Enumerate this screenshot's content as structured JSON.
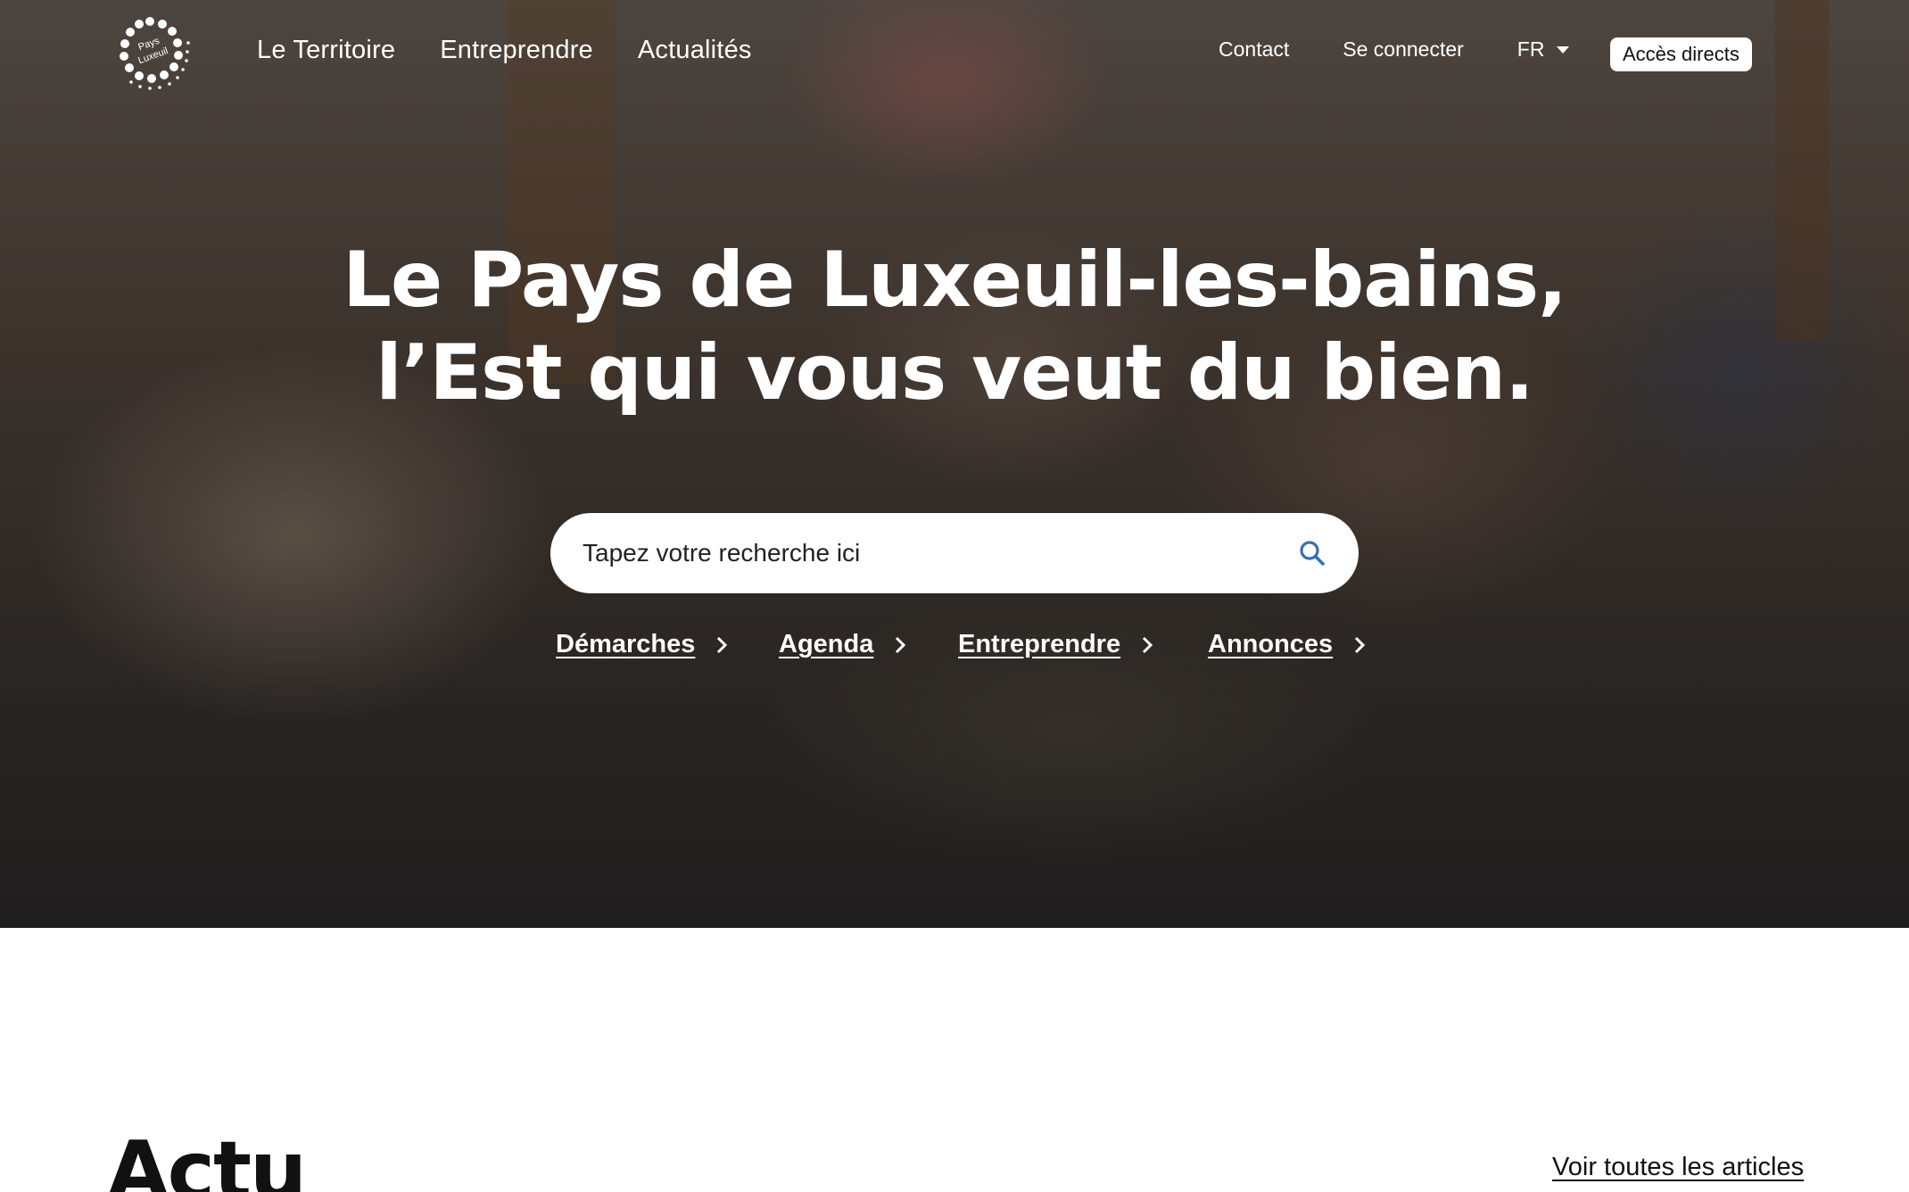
{
  "header": {
    "logo_text": "Pays de Luxeuil",
    "nav": [
      {
        "label": "Le Territoire"
      },
      {
        "label": "Entreprendre"
      },
      {
        "label": "Actualités"
      }
    ],
    "contact_label": "Contact",
    "login_label": "Se connecter",
    "language": "FR",
    "quick_access_label": "Accès directs"
  },
  "hero": {
    "headline_line1": "Le Pays de Luxeuil-les-bains,",
    "headline_line2": "l’Est qui vous veut du bien.",
    "search": {
      "placeholder": "Tapez votre recherche ici",
      "icon": "search-icon"
    },
    "quick_links": [
      {
        "label": "Démarches"
      },
      {
        "label": "Agenda"
      },
      {
        "label": "Entreprendre"
      },
      {
        "label": "Annonces"
      }
    ]
  },
  "news": {
    "title": "Actu",
    "see_all_label": "Voir toutes les articles"
  },
  "colors": {
    "accent_search_icon": "#3a6fb0",
    "text_white": "#ffffff",
    "text_dark": "#111111"
  }
}
